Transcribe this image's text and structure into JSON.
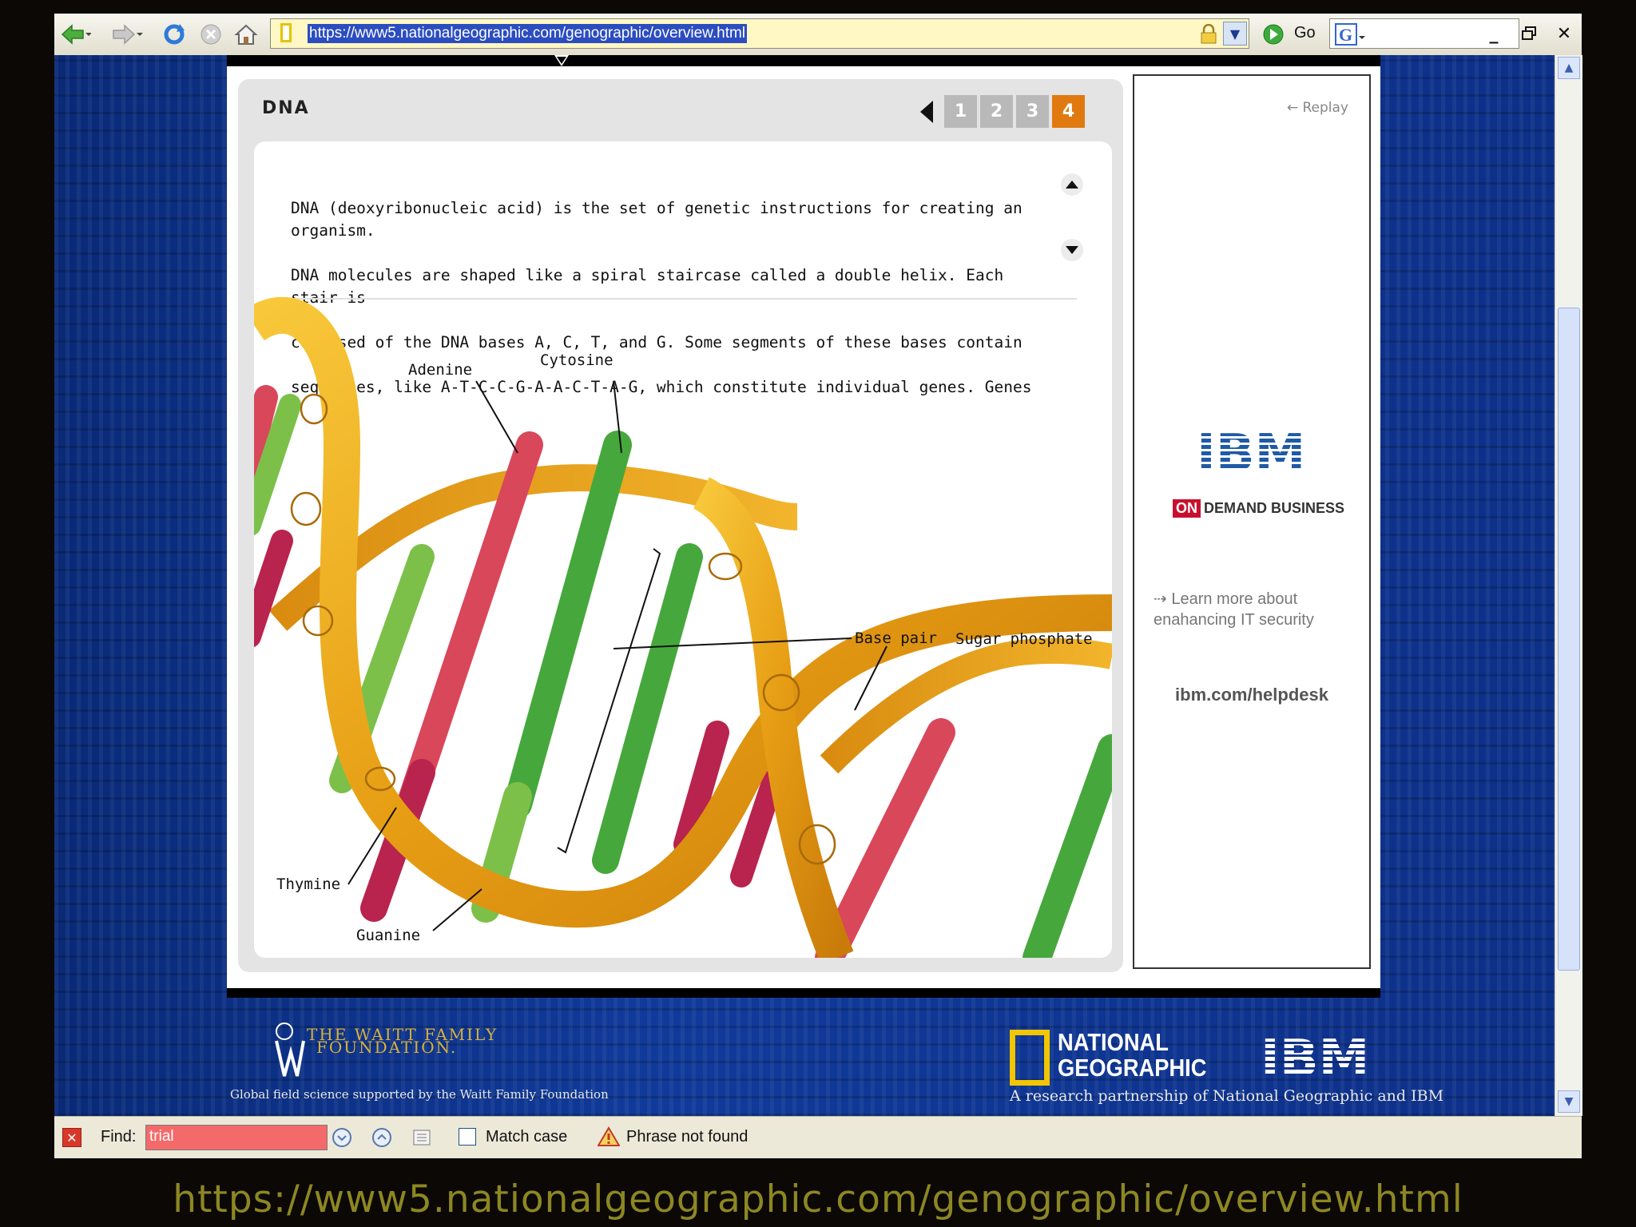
{
  "browser": {
    "url": "https://www5.nationalgeographic.com/genographic/overview.html",
    "go_label": "Go",
    "search_value": ""
  },
  "dna": {
    "title": "DNA",
    "pages": [
      "1",
      "2",
      "3",
      "4"
    ],
    "active_page": "4",
    "description_lines": [
      "DNA (deoxyribonucleic acid) is the set of genetic instructions for creating an organism.",
      "DNA molecules are shaped like a spiral staircase called a double helix. Each stair is",
      "composed of the DNA bases A, C, T, and G. Some segments of these bases contain",
      "sequences, like A-T-C-C-G-A-A-C-T-A-G, which constitute individual genes. Genes"
    ],
    "labels": {
      "adenine": "Adenine",
      "cytosine": "Cytosine",
      "base_pair": "Base pair",
      "sugar_phosphate": "Sugar phosphate",
      "thymine": "Thymine",
      "guanine": "Guanine"
    },
    "colors": {
      "ribbon": "#f0a818",
      "adenine": "#d9475a",
      "thymine": "#b8244e",
      "cytosine": "#46a83c",
      "guanine": "#7cc04a",
      "active_page": "#e07a10"
    }
  },
  "ad": {
    "replay": "← Replay",
    "brand": "IBM",
    "on_label": "ON",
    "tagline": "DEMAND BUSINESS",
    "learn_more": "Learn more about enahancing IT security",
    "url": "ibm.com/helpdesk"
  },
  "footer": {
    "waitt_name_line1": "THE WAITT FAMILY",
    "waitt_name_line2": "FOUNDATION.",
    "waitt_tagline": "Global field science supported by the Waitt Family Foundation",
    "natgeo_line1": "NATIONAL",
    "natgeo_line2": "GEOGRAPHIC",
    "partnership": "A research partnership of National Geographic and IBM"
  },
  "findbar": {
    "label": "Find:",
    "query": "trial",
    "match_case": "Match case",
    "status": "Phrase not found"
  },
  "caption": "https://www5.nationalgeographic.com/genographic/overview.html"
}
